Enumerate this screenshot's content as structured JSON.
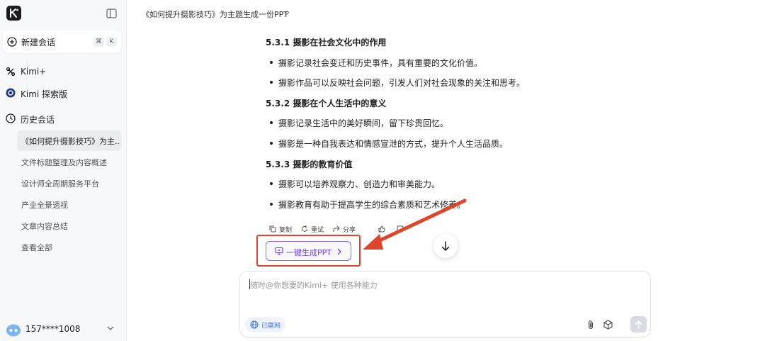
{
  "sidebar": {
    "new_chat": "新建会话",
    "shortcut_cmd": "⌘",
    "shortcut_key": "K",
    "nav": [
      {
        "label": "Kimi+"
      },
      {
        "label": "Kimi 探索版"
      },
      {
        "label": "历史会话"
      }
    ],
    "history": [
      "《如何提升摄影技巧》为主...",
      "文件标题整理及内容概述",
      "设计师全周期服务平台",
      "产业全景透视",
      "文章内容总结",
      "查看全部"
    ],
    "user": "157****1008"
  },
  "header": {
    "title": "《如何提升摄影技巧》为主题生成一份PPT"
  },
  "content": {
    "sections": [
      {
        "heading": "5.3.1 摄影在社会文化中的作用",
        "items": [
          "摄影记录社会变迁和历史事件，具有重要的文化价值。",
          "摄影作品可以反映社会问题，引发人们对社会现象的关注和思考。"
        ]
      },
      {
        "heading": "5.3.2 摄影在个人生活中的意义",
        "items": [
          "摄影记录生活中的美好瞬间，留下珍贵回忆。",
          "摄影是一种自我表达和情感宣泄的方式，提升个人生活品质。"
        ]
      },
      {
        "heading": "5.3.3 摄影的教育价值",
        "items": [
          "摄影可以培养观察力、创造力和审美能力。",
          "摄影教育有助于提高学生的综合素质和艺术修养。"
        ]
      }
    ],
    "actions": {
      "copy": "复制",
      "retry": "重试",
      "share": "分享"
    },
    "ppt_button": "一键生成PPT"
  },
  "input": {
    "placeholder": "随时@你想要的Kimi+ 使用各种能力",
    "online": "已联网"
  },
  "colors": {
    "accent": "#6b3ef0",
    "highlight": "#e0452b",
    "online": "#3b6fe8"
  }
}
